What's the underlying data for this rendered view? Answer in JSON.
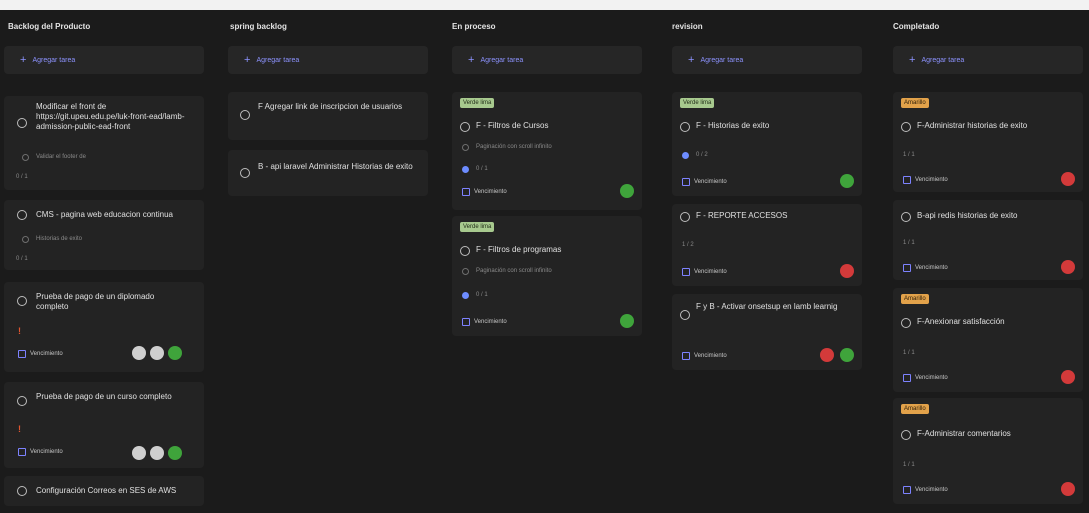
{
  "columns": [
    {
      "title": "Backlog del Producto",
      "add_label": "Agregar tarea",
      "cards": [
        {
          "title": "Modificar el front de https://git.upeu.edu.pe/luk-front-ead/lamb-admission-public-ead-front",
          "subtask": "Validar el footer de",
          "progress": "0 / 1"
        },
        {
          "title": "CMS - pagina web educacion continua",
          "subtask": "Historias de exito",
          "progress": "0 / 1"
        },
        {
          "title": "Prueba de pago de un diplomado completo",
          "mark": "!",
          "due": "Vencimiento"
        },
        {
          "title": "Prueba de pago de un curso completo",
          "mark": "!",
          "due": "Vencimiento"
        },
        {
          "title": "Configuración Correos en SES de AWS"
        }
      ]
    },
    {
      "title": "spring backlog",
      "add_label": "Agregar tarea",
      "cards": [
        {
          "title": "F Agregar link de inscripcion de usuarios"
        },
        {
          "title": "B - api laravel Administrar Historias de exito"
        }
      ]
    },
    {
      "title": "En proceso",
      "add_label": "Agregar tarea",
      "cards": [
        {
          "tag": "Verde lima",
          "title": "F - Filtros de Cursos",
          "subtask": "Paginación con scroll infinito",
          "progress": "0 / 1",
          "due": "Vencimiento"
        },
        {
          "tag": "Verde lima",
          "title": "F - Filtros de programas",
          "subtask": "Paginación con scroll infinito",
          "progress": "0 / 1",
          "due": "Vencimiento"
        }
      ]
    },
    {
      "title": "revision",
      "add_label": "Agregar tarea",
      "cards": [
        {
          "tag": "Verde lima",
          "title": "F - Historias de exito",
          "progress": "0 / 2",
          "due": "Vencimiento"
        },
        {
          "title": "F - REPORTE ACCESOS",
          "progress": "1 / 2",
          "due": "Vencimiento"
        },
        {
          "title": "F y B - Activar onsetsup en lamb learnig",
          "due": "Vencimiento"
        }
      ]
    },
    {
      "title": "Completado",
      "add_label": "Agregar tarea",
      "cards": [
        {
          "tag": "Amarillo",
          "title": "F-Administrar historias de exito",
          "progress": "1 / 1",
          "due": "Vencimiento"
        },
        {
          "title": "B-api redis historias de exito",
          "progress": "1 / 1",
          "due": "Vencimiento"
        },
        {
          "tag": "Amarillo",
          "title": "F-Anexionar satisfacción",
          "progress": "1 / 1",
          "due": "Vencimiento"
        },
        {
          "tag": "Amarillo",
          "title": "F-Administrar comentarios",
          "progress": "1 / 1",
          "due": "Vencimiento"
        }
      ]
    }
  ],
  "colors": {
    "background": "#1b1b1b",
    "card": "#232323",
    "accent": "#8d93ff",
    "tag_green": "#a7c98e",
    "tag_orange": "#e2a24a",
    "badge_green": "#3fa43b",
    "badge_red": "#d33a3a"
  }
}
